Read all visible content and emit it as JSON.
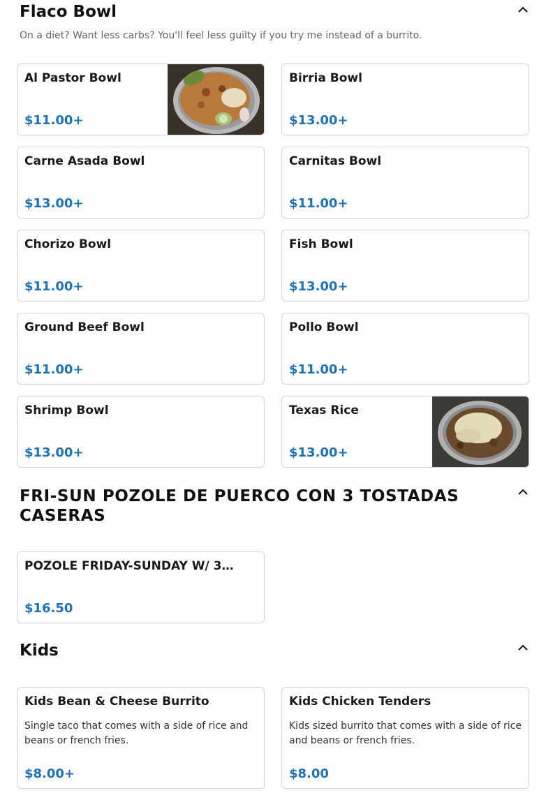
{
  "sections": [
    {
      "title": "Flaco Bowl",
      "description": "On a diet? Want less carbs? You'll feel less guilty if you try me instead of a burrito.",
      "items": [
        {
          "name": "Al Pastor Bowl",
          "price": "$11.00+",
          "image": "al-pastor-bowl-photo"
        },
        {
          "name": "Birria Bowl",
          "price": "$13.00+"
        },
        {
          "name": "Carne Asada Bowl",
          "price": "$13.00+"
        },
        {
          "name": "Carnitas Bowl",
          "price": "$11.00+"
        },
        {
          "name": "Chorizo Bowl",
          "price": "$11.00+"
        },
        {
          "name": "Fish Bowl",
          "price": "$13.00+"
        },
        {
          "name": "Ground Beef Bowl",
          "price": "$11.00+"
        },
        {
          "name": "Pollo Bowl",
          "price": "$11.00+"
        },
        {
          "name": "Shrimp Bowl",
          "price": "$13.00+"
        },
        {
          "name": "Texas Rice",
          "price": "$13.00+",
          "image": "texas-rice-photo"
        }
      ]
    },
    {
      "title": "FRI-SUN POZOLE DE PUERCO CON 3 TOSTADAS CASERAS",
      "items": [
        {
          "name": "POZOLE FRIDAY-SUNDAY W/ 3…",
          "price": "$16.50"
        }
      ]
    },
    {
      "title": "Kids",
      "items": [
        {
          "name": "Kids Bean & Cheese Burrito",
          "description": "Single taco that comes with a side of rice and beans or french fries.",
          "price": "$8.00+"
        },
        {
          "name": "Kids Chicken Tenders",
          "description": "Kids sized burrito that comes with a side of rice and beans or french fries.",
          "price": "$8.00"
        }
      ]
    }
  ],
  "icons": {
    "collapse": "chevron-up-icon"
  },
  "colors": {
    "price": "#2171b5",
    "border": "#d4d4d4"
  }
}
